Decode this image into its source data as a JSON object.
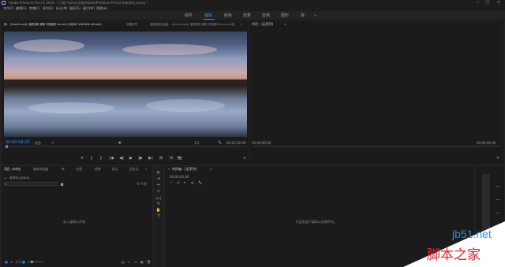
{
  "titlebar": {
    "title": "Adobe Premiere Pro CC 2018 - C:\\用户\\jiehy\\文档\\Adobe\\Premiere Pro\\12.0\\未命名.prproj *",
    "minimize": "—",
    "maximize": "□",
    "close": "✕"
  },
  "menu": {
    "items": [
      "文件(F)",
      "编辑(E)",
      "剪辑(C)",
      "序列(S)",
      "标记(M)",
      "图形(G)",
      "窗口(W)",
      "帮助(H)"
    ]
  },
  "workspaces": {
    "items": [
      "组件",
      "编辑",
      "颜色",
      "效果",
      "音频",
      "图形",
      "库"
    ],
    "active": "编辑",
    "more": "»"
  },
  "source_panel": {
    "tab_source": "源：【Lovelt.com】速秀剪辑 视频 中国素材 ws.com 片段(NO.KIN.MAX.16.mp4)",
    "tab_effects": "效果控件",
    "tab_audio": "音频剪辑混合器：【Lovelt.com】速秀剪辑 视频 中国素材 ws.com 片段",
    "menu_icon": "≡",
    "expand": "»",
    "timecode_in": "00:00:08:20",
    "zoom": "适合",
    "page_label": "1/2",
    "timecode_dur": "00:00:32:09",
    "controls": [
      "▾",
      "{",
      "}",
      "|◀",
      "◀|",
      "▶",
      "|▶",
      "▶|",
      "⊞",
      "⊟",
      "📷",
      "+"
    ]
  },
  "program_panel": {
    "tab": "节目：(无序列)",
    "menu_icon": "≡",
    "timecode_left": "00;00;00;00",
    "timecode_right": "00;00;00;00",
    "add": "+"
  },
  "project_panel": {
    "tabs": [
      "项目: 未命名",
      "媒体浏览器",
      "库",
      "信息",
      "效果",
      "标记",
      "历史记"
    ],
    "expand": "»",
    "file": "未命名.prproj",
    "items_count": "0 个项",
    "search_placeholder": "",
    "empty_text": "导入媒体以开始",
    "footer_zoom": "1:1"
  },
  "tools": [
    "▶",
    "⇥",
    "↔",
    "✂",
    "|↔|",
    "✎",
    "✋",
    "T"
  ],
  "timeline_panel": {
    "tab": "时间轴：(无序列)",
    "menu_icon": "≡",
    "timecode": "00;00;00;00",
    "empty_text": "在此处放下媒体以创建序列。"
  },
  "watermark": {
    "line1": "jb51.net",
    "line2": "脚本之家"
  },
  "colors": {
    "accent": "#2d8ceb",
    "panel_bg": "#1b1b1b",
    "app_bg": "#232323"
  }
}
